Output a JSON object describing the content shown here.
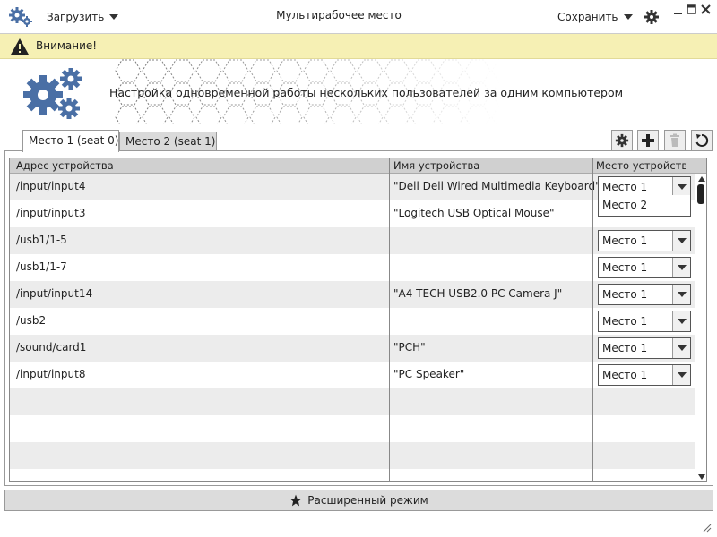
{
  "titlebar": {
    "title": "Мультирабочее место",
    "load_label": "Загрузить",
    "save_label": "Сохранить"
  },
  "warning": {
    "text": "Внимание!"
  },
  "header": {
    "description": "Настройка одновременной работы нескольких пользователей за одним компьютером"
  },
  "tabs": [
    {
      "label": "Место 1 (seat 0)",
      "active": true
    },
    {
      "label": "Место 2 (seat 1)",
      "active": false
    }
  ],
  "toolbar": {
    "icons": [
      "gear-icon",
      "plus-icon",
      "trash-icon",
      "refresh-icon"
    ],
    "delete_disabled": true
  },
  "table": {
    "columns": [
      "Адрес устройства",
      "Имя устройства",
      "Место устройства"
    ],
    "rows": [
      {
        "address": "/input/input4",
        "name": "\"Dell Dell Wired Multimedia Keyboard\"",
        "seat": "Место 1"
      },
      {
        "address": "/input/input3",
        "name": "\"Logitech USB Optical Mouse\"",
        "seat": "Место 1"
      },
      {
        "address": "/usb1/1-5",
        "name": "",
        "seat": "Место 1"
      },
      {
        "address": "/usb1/1-7",
        "name": "",
        "seat": "Место 1"
      },
      {
        "address": "/input/input14",
        "name": "\"A4 TECH USB2.0 PC Camera J\"",
        "seat": "Место 1"
      },
      {
        "address": "/usb2",
        "name": "",
        "seat": "Место 1"
      },
      {
        "address": "/sound/card1",
        "name": "\"PCH\"",
        "seat": "Место 1"
      },
      {
        "address": "/input/input8",
        "name": "\"PC Speaker\"",
        "seat": "Место 1"
      }
    ],
    "open_dropdown_option": "Место 2"
  },
  "advanced_button": {
    "label": "Расширенный режим",
    "icon": "star-icon"
  },
  "colors": {
    "warning_bg": "#f6f0b4",
    "gear_blue": "#4a6fa5",
    "header_bg": "#d0d0d0",
    "alt_row": "#ececec"
  }
}
